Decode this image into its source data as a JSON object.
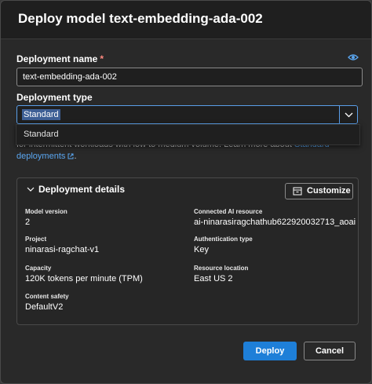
{
  "dialog": {
    "title": "Deploy model text-embedding-ada-002"
  },
  "deployment_name": {
    "label": "Deployment name",
    "required_marker": "*",
    "value": "text-embedding-ada-002",
    "icon": "eye-icon"
  },
  "deployment_type": {
    "label": "Deployment type",
    "selected": "Standard",
    "options": [
      "Standard"
    ]
  },
  "description": {
    "text": "for intermittent workloads with low to medium volume. Learn more about",
    "link_text_1": "Standard",
    "link_text_2": "deployments",
    "end": "."
  },
  "details": {
    "title": "Deployment details",
    "customize_label": "Customize",
    "fields": {
      "model_version": {
        "label": "Model version",
        "value": "2"
      },
      "connected_ai_resource": {
        "label": "Connected AI resource",
        "value": "ai-ninarasiragchathub622920032713_aoai"
      },
      "project": {
        "label": "Project",
        "value": "ninarasi-ragchat-v1"
      },
      "authentication_type": {
        "label": "Authentication type",
        "value": "Key"
      },
      "capacity": {
        "label": "Capacity",
        "value": "120K tokens per minute (TPM)"
      },
      "resource_location": {
        "label": "Resource location",
        "value": "East US 2"
      },
      "content_safety": {
        "label": "Content safety",
        "value": "DefaultV2"
      }
    }
  },
  "actions": {
    "deploy": "Deploy",
    "cancel": "Cancel"
  },
  "colors": {
    "accent": "#1e7fd8",
    "link": "#5aa6f0",
    "required": "#ff8a80",
    "focus_border": "#5a9ee8"
  }
}
